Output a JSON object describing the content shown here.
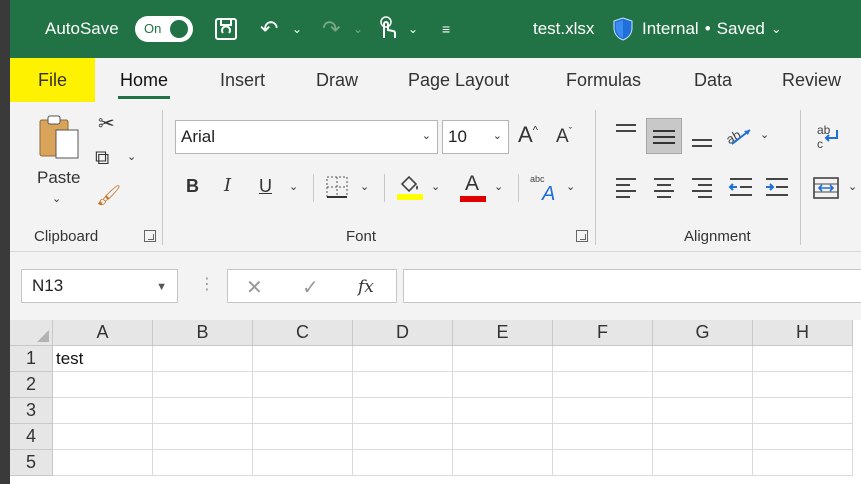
{
  "titlebar": {
    "autosave_label": "AutoSave",
    "autosave_state": "On",
    "filename": "test.xlsx",
    "sensitivity": "Internal",
    "separator": "•",
    "save_status": "Saved",
    "accent_color": "#217346"
  },
  "tabs": [
    {
      "label": "File"
    },
    {
      "label": "Home"
    },
    {
      "label": "Insert"
    },
    {
      "label": "Draw"
    },
    {
      "label": "Page Layout"
    },
    {
      "label": "Formulas"
    },
    {
      "label": "Data"
    },
    {
      "label": "Review"
    }
  ],
  "ribbon": {
    "clipboard": {
      "paste_label": "Paste",
      "group_label": "Clipboard"
    },
    "font": {
      "font_name": "Arial",
      "font_size": "10",
      "bold": "B",
      "italic": "I",
      "underline": "U",
      "grow": "A",
      "shrink": "A",
      "font_color_glyph": "A",
      "group_label": "Font",
      "fill_color": "#ffff00",
      "font_color": "#e00000"
    },
    "alignment": {
      "group_label": "Alignment"
    }
  },
  "formula_bar": {
    "name_box": "N13",
    "fx_label": "fx",
    "formula_value": ""
  },
  "grid": {
    "columns": [
      "A",
      "B",
      "C",
      "D",
      "E",
      "F",
      "G",
      "H"
    ],
    "rows": [
      "1",
      "2",
      "3",
      "4",
      "5"
    ],
    "cells": {
      "A1": "test"
    }
  }
}
